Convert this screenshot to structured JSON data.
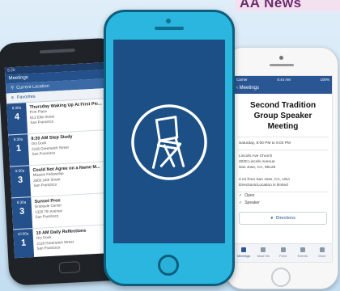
{
  "banner": {
    "text": "AA News"
  },
  "android": {
    "status": "5:26",
    "app_title": "Meetings",
    "search": "Current Location",
    "filter": "Favorites",
    "meetings": [
      {
        "time": "6:30a",
        "day": "4",
        "name": "Thursday Waking Up At First Pic...",
        "place": "First Place",
        "address": "613 Ellis Street",
        "city": "San Francisco"
      },
      {
        "time": "6:30a",
        "day": "1",
        "name": "8:30 AM Step Study",
        "place": "Dry Dock",
        "address": "2118 Greenwich Street",
        "city": "San Francisco"
      },
      {
        "time": "6:30a",
        "day": "3",
        "name": "Could Not Agree on a Name M...",
        "place": "Mission Fellowship",
        "address": "2900 24th Street",
        "city": "San Francisco"
      },
      {
        "time": "6:30a",
        "day": "3",
        "name": "Sunset Pros",
        "place": "Gratitude Center",
        "address": "1320 7th Avenue",
        "city": "San Francisco"
      },
      {
        "time": "10:00a",
        "day": "1",
        "name": "10 AM Daily Reflections",
        "place": "Dry Dock",
        "address": "2118 Greenwich Street",
        "city": "San Francisco"
      }
    ]
  },
  "center": {
    "logo_icon": "folding-chair-icon"
  },
  "right": {
    "status_left": "Carrier",
    "status_center": "5:44 AM",
    "status_right": "100%",
    "nav_back": "Meetings",
    "title": "Second Tradition Group Speaker Meeting",
    "when": "Saturday, 8:00 PM to 9:00 PM",
    "location": [
      "Lincoln Ave Church",
      "2030 Lincoln Avenue",
      "San Jose, CA, 95125"
    ],
    "group_note": [
      "4 mi from San Jose, CA, USA",
      "Directions/Location is limited"
    ],
    "types": [
      "Open",
      "Speaker"
    ],
    "directions_label": "Directions",
    "tabs": [
      "Meetings",
      "Near Me",
      "Feed",
      "Events",
      "More"
    ]
  }
}
